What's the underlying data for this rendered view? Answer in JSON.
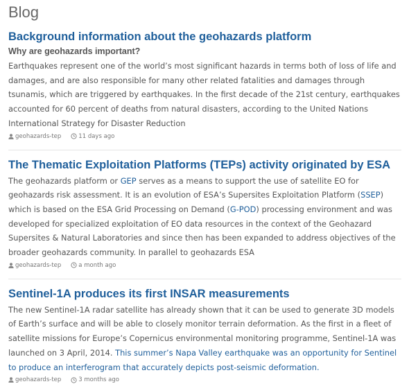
{
  "blog_heading": "Blog",
  "posts": [
    {
      "title": "Background information about the geohazards platform",
      "subtitle": "Why are geohazards important?",
      "body": "Earthquakes represent one of the world’s most significant hazards in terms both of loss of life and damages, and are also responsible for many other related fatalities and damages through tsunamis, which are triggered by earthquakes. In the first decade of the 21st century, earthquakes accounted for 60 percent of deaths from natural disasters, according to the United Nations International Strategy for Disaster Reduction",
      "author": "geohazards-tep",
      "time": "11 days ago"
    },
    {
      "title": "The Thematic Exploitation Platforms (TEPs) activity originated by ESA",
      "body_parts": [
        "The geohazards platform or ",
        "GEP",
        " serves as a means to support the use of satellite EO for geohazards risk assessment. It is an evolution of ESA’s Supersites Exploitation Platform (",
        "SSEP",
        ") which is based on the ESA Grid Processing on Demand (",
        "G-POD",
        ") processing environment and was developed for specialized exploitation of EO data resources in the context of the Geohazard Supersites & Natural Laboratories and since then has been expanded to address objectives of the broader geohazards community. In parallel to geohazards ESA"
      ],
      "author": "geohazards-tep",
      "time": "a month ago"
    },
    {
      "title": "Sentinel-1A produces its first INSAR measurements",
      "body_text": "The new Sentinel-1A radar satellite has already shown that it can be used to generate 3D models of Earth’s surface and will be able to closely monitor terrain deformation. As the first in a fleet of satellite missions for Europe’s Copernicus environmental monitoring programme, Sentinel-1A was launched on 3 April, 2014. ",
      "body_link": "This summer’s Napa Valley earthquake was an opportunity for Sentinel to produce an interferogram that accurately depicts post-seismic deformation.",
      "author": "geohazards-tep",
      "time": "3 months ago"
    }
  ],
  "colors": {
    "link": "#1f5f9b",
    "text": "#555555",
    "muted": "#777777",
    "divider": "#e5e5e5"
  },
  "icons": {
    "author": "user-icon",
    "time": "clock-icon"
  }
}
